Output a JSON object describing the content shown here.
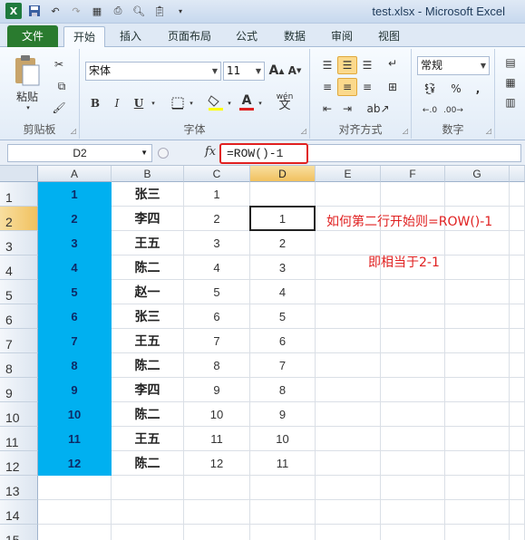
{
  "window": {
    "title": "test.xlsx - Microsoft Excel"
  },
  "quick_access": {
    "logo": "X"
  },
  "ribbon_tabs": [
    {
      "label": "文件"
    },
    {
      "label": "开始"
    },
    {
      "label": "插入"
    },
    {
      "label": "页面布局"
    },
    {
      "label": "公式"
    },
    {
      "label": "数据"
    },
    {
      "label": "审阅"
    },
    {
      "label": "视图"
    }
  ],
  "ribbon": {
    "clipboard": {
      "label": "剪贴板",
      "paste_label": "粘贴"
    },
    "font": {
      "label": "字体",
      "font_name": "宋体",
      "font_size": "11",
      "bold": "B",
      "italic": "I",
      "underline": "U",
      "wen": "wén",
      "font_color_char": "A"
    },
    "alignment": {
      "label": "对齐方式"
    },
    "number": {
      "label": "数字",
      "format": "常规",
      "percent": "%",
      "comma": ","
    }
  },
  "formula_bar": {
    "name_box": "D2",
    "fx_label": "fx",
    "formula": "=ROW()-1"
  },
  "columns": [
    "A",
    "B",
    "C",
    "D",
    "E",
    "F",
    "G"
  ],
  "rows": [
    {
      "row": "1",
      "A": "1",
      "B": "张三",
      "C": "1",
      "D": ""
    },
    {
      "row": "2",
      "A": "2",
      "B": "李四",
      "C": "2",
      "D": "1"
    },
    {
      "row": "3",
      "A": "3",
      "B": "王五",
      "C": "3",
      "D": "2"
    },
    {
      "row": "4",
      "A": "4",
      "B": "陈二",
      "C": "4",
      "D": "3"
    },
    {
      "row": "5",
      "A": "5",
      "B": "赵一",
      "C": "5",
      "D": "4"
    },
    {
      "row": "6",
      "A": "6",
      "B": "张三",
      "C": "6",
      "D": "5"
    },
    {
      "row": "7",
      "A": "7",
      "B": "王五",
      "C": "7",
      "D": "6"
    },
    {
      "row": "8",
      "A": "8",
      "B": "陈二",
      "C": "8",
      "D": "7"
    },
    {
      "row": "9",
      "A": "9",
      "B": "李四",
      "C": "9",
      "D": "8"
    },
    {
      "row": "10",
      "A": "10",
      "B": "陈二",
      "C": "10",
      "D": "9"
    },
    {
      "row": "11",
      "A": "11",
      "B": "王五",
      "C": "11",
      "D": "10"
    },
    {
      "row": "12",
      "A": "12",
      "B": "陈二",
      "C": "12",
      "D": "11"
    },
    {
      "row": "13",
      "A": "",
      "B": "",
      "C": "",
      "D": ""
    },
    {
      "row": "14",
      "A": "",
      "B": "",
      "C": "",
      "D": ""
    },
    {
      "row": "15",
      "A": "",
      "B": "",
      "C": "",
      "D": ""
    }
  ],
  "annotations": {
    "note1": "如何第二行开始则=ROW()-1",
    "note2": "即相当于2-1"
  },
  "colors": {
    "highlight_fill": "#00b0f0",
    "annotation": "#e02020",
    "file_tab": "#2a7b2f"
  }
}
